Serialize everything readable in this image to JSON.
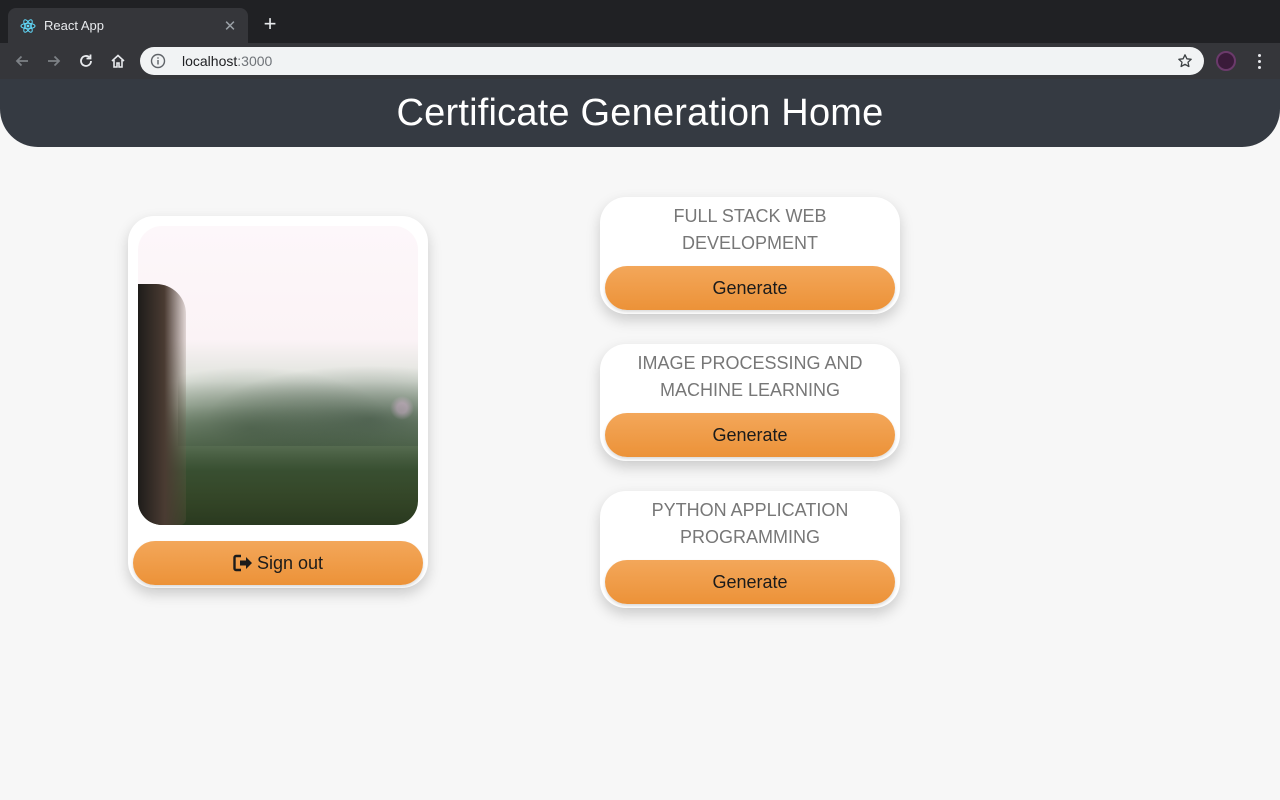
{
  "browser": {
    "tab_title": "React App",
    "url_host": "localhost",
    "url_port": ":3000"
  },
  "header": {
    "title": "Certificate Generation Home"
  },
  "profile": {
    "signout_label": "Sign out"
  },
  "courses": [
    {
      "title": "FULL STACK WEB DEVELOPMENT",
      "button_label": "Generate"
    },
    {
      "title": "IMAGE PROCESSING AND MACHINE LEARNING",
      "button_label": "Generate"
    },
    {
      "title": "PYTHON APPLICATION PROGRAMMING",
      "button_label": "Generate"
    }
  ],
  "colors": {
    "header_bg": "#353a42",
    "button_orange": "#ec9238",
    "page_bg": "#f7f7f7"
  }
}
